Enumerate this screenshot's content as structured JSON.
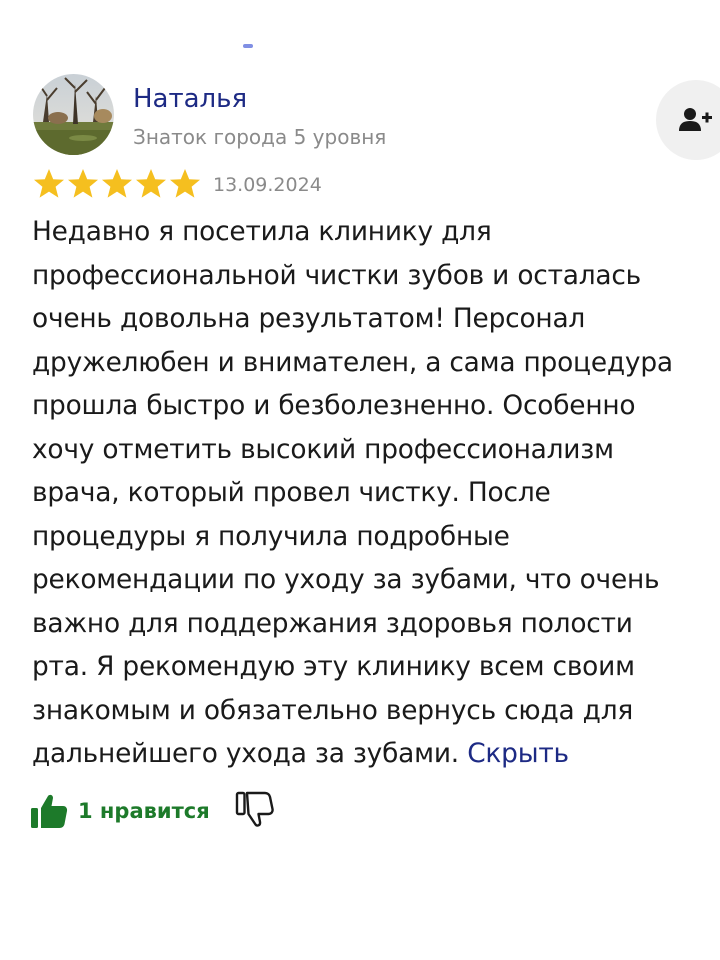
{
  "review": {
    "author": {
      "name": "Наталья",
      "level": "Знаток города 5 уровня",
      "avatar_icon": "avatar-photo-park"
    },
    "subscribe_icon": "add-user-icon",
    "rating": 5,
    "date": "13.09.2024",
    "text_lines": [
      "Недавно я посетила клинику для",
      "профессиональной чистки зубов и осталась",
      "очень довольна результатом! Персонал",
      "дружелюбен и внимателен, а сама процедура",
      "прошла быстро и безболезненно. Особенно",
      "хочу отметить высокий профессионализм",
      "врача, который провел чистку. После",
      "процедуры я получила подробные",
      "рекомендации по уходу за зубами, что очень",
      "важно для поддержания здоровья полости",
      "рта. Я рекомендую эту клинику всем своим",
      "знакомым и обязательно вернусь сюда для",
      "дальнейшего ухода за зубами."
    ],
    "hide_label": "Скрыть",
    "likes": {
      "label": "1 нравится",
      "like_icon": "thumbs-up-icon",
      "dislike_icon": "thumbs-down-icon"
    }
  },
  "colors": {
    "name": "#1d2a84",
    "link": "#1d2a84",
    "star": "#f5bf1f",
    "like": "#1d7a2a",
    "muted": "#8a8a8a"
  }
}
